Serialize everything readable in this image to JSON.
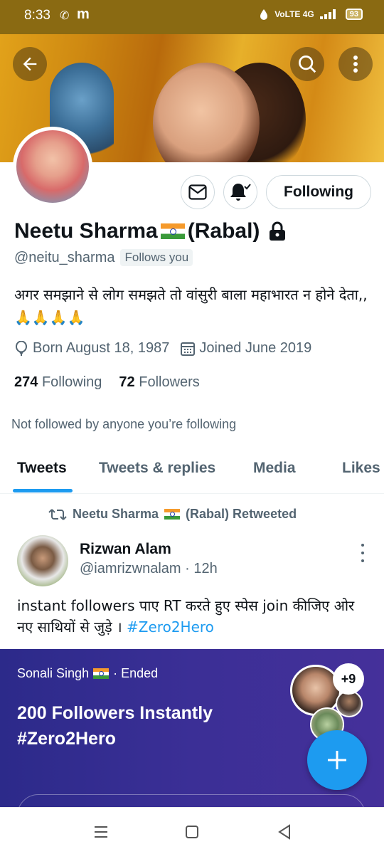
{
  "status_bar": {
    "time": "8:33",
    "whatsapp_glyph": "✆",
    "app_glyph": "m",
    "network": "VoLTE 4G",
    "battery": "93"
  },
  "header": {
    "back_icon": "arrow-left-icon",
    "search_icon": "search-icon",
    "more_icon": "more-vertical-icon"
  },
  "profile": {
    "name": "Neetu Sharma",
    "name_suffix": "(Rabal)",
    "handle": "@neitu_sharma",
    "follows_you": "Follows you",
    "bio": "अगर समझाने से लोग समझते तो वांसुरी बाला महाभारत न होने देता,,🙏🙏🙏🙏",
    "born": "Born August 18, 1987",
    "joined": "Joined June 2019",
    "following_count": "274",
    "following_label": "Following",
    "followers_count": "72",
    "followers_label": "Followers",
    "not_followed": "Not followed by anyone you’re following",
    "following_button": "Following"
  },
  "tabs": [
    {
      "label": "Tweets"
    },
    {
      "label": "Tweets & replies"
    },
    {
      "label": "Media"
    },
    {
      "label": "Likes"
    }
  ],
  "tweet": {
    "retweet_label": "Neetu Sharma",
    "retweet_suffix": "(Rabal) Retweeted",
    "author_name": "Rizwan Alam",
    "author_handle": "@iamrizwnalam · 12h",
    "text": "instant followers पाए  RT करते हुए स्पेस join कीजिए ओर नए साथियों से जुड़े । ",
    "hashtag": "#Zero2Hero"
  },
  "space": {
    "host": "Sonali Singh",
    "status": "· Ended",
    "title": "200 Followers Instantly #Zero2Hero",
    "extra_count": "+9"
  },
  "colors": {
    "accent": "#1d9bf0",
    "status_bar": "#8a6a12",
    "space_bg": "#3b2f96"
  }
}
